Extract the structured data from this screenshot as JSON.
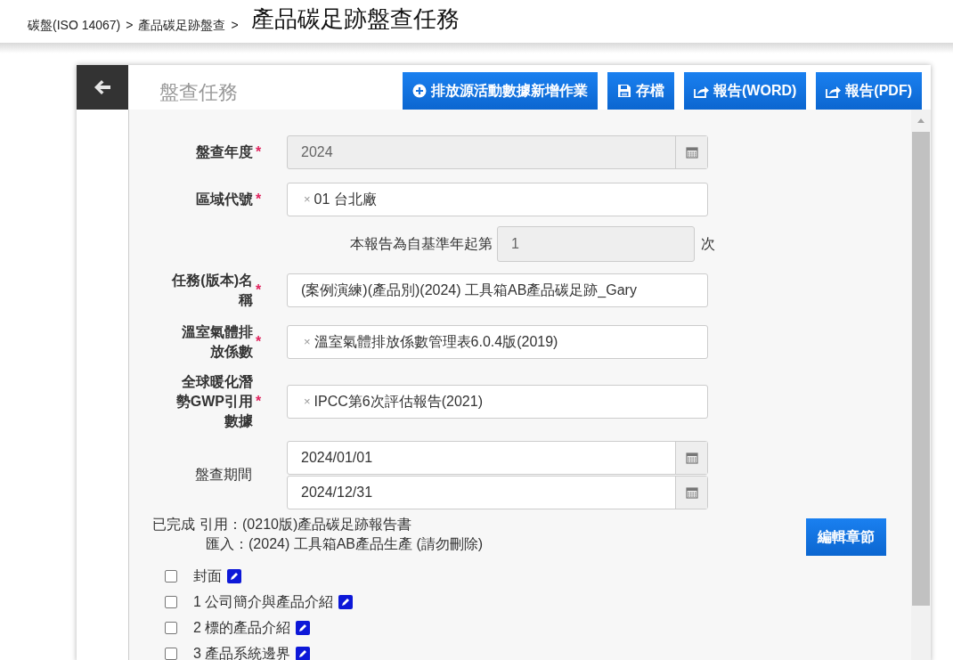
{
  "breadcrumb": [
    {
      "label": "碳盤(ISO 14067)",
      "separator": ">"
    },
    {
      "label": "產品碳足跡盤查",
      "separator": ">"
    }
  ],
  "page_title": "產品碳足跡盤查任務",
  "card": {
    "title": "盤查任務",
    "toolbar": [
      {
        "label": "排放源活動數據新增作業",
        "kind": "plus"
      },
      {
        "label": "存檔",
        "kind": "save"
      },
      {
        "label": "報告(WORD)",
        "kind": "share"
      },
      {
        "label": "報告(PDF)",
        "kind": "share"
      }
    ]
  },
  "form": {
    "fields": [
      {
        "kind": "date",
        "label": "盤查年度",
        "required_mark": "*",
        "value": "2024",
        "disabled": true
      },
      {
        "kind": "tags",
        "label": "區域代號",
        "required_mark": "*",
        "remove": "×",
        "value": "01 台北廠"
      },
      {
        "kind": "counter",
        "prefix": "本報告為自基準年起第",
        "value": "1",
        "suffix": "次",
        "disabled": true
      },
      {
        "kind": "text",
        "label": "任務(版本)名稱",
        "required_mark": "*",
        "value": "(案例演練)(產品別)(2024) 工具箱AB產品碳足跡_Gary"
      },
      {
        "kind": "tags",
        "label": "溫室氣體排放係數",
        "required_mark": "*",
        "remove": "×",
        "value": "溫室氣體排放係數管理表6.0.4版(2019)"
      },
      {
        "kind": "tags",
        "label": "全球暖化潛勢**GWP**引用數據",
        "required_mark": "*",
        "remove": "×",
        "value": "IPCC第6次評估報告(2021)"
      },
      {
        "kind": "date_range",
        "label": "盤查期間",
        "values": [
          "2024/01/01",
          "2024/12/31"
        ]
      }
    ]
  },
  "status": {
    "state": "已完成",
    "reference": "引用：(0210版)產品碳足跡報告書",
    "import": "匯入：(2024) 工具箱AB產品生產 (請勿刪除)"
  },
  "edit_button": "編輯章節",
  "chapters": [
    {
      "label": "封面",
      "checked": false
    },
    {
      "label": "1 公司簡介與產品介紹",
      "checked": false
    },
    {
      "label": "2 標的產品介紹",
      "checked": false
    },
    {
      "label": "3 產品系統邊界",
      "checked": false
    }
  ]
}
